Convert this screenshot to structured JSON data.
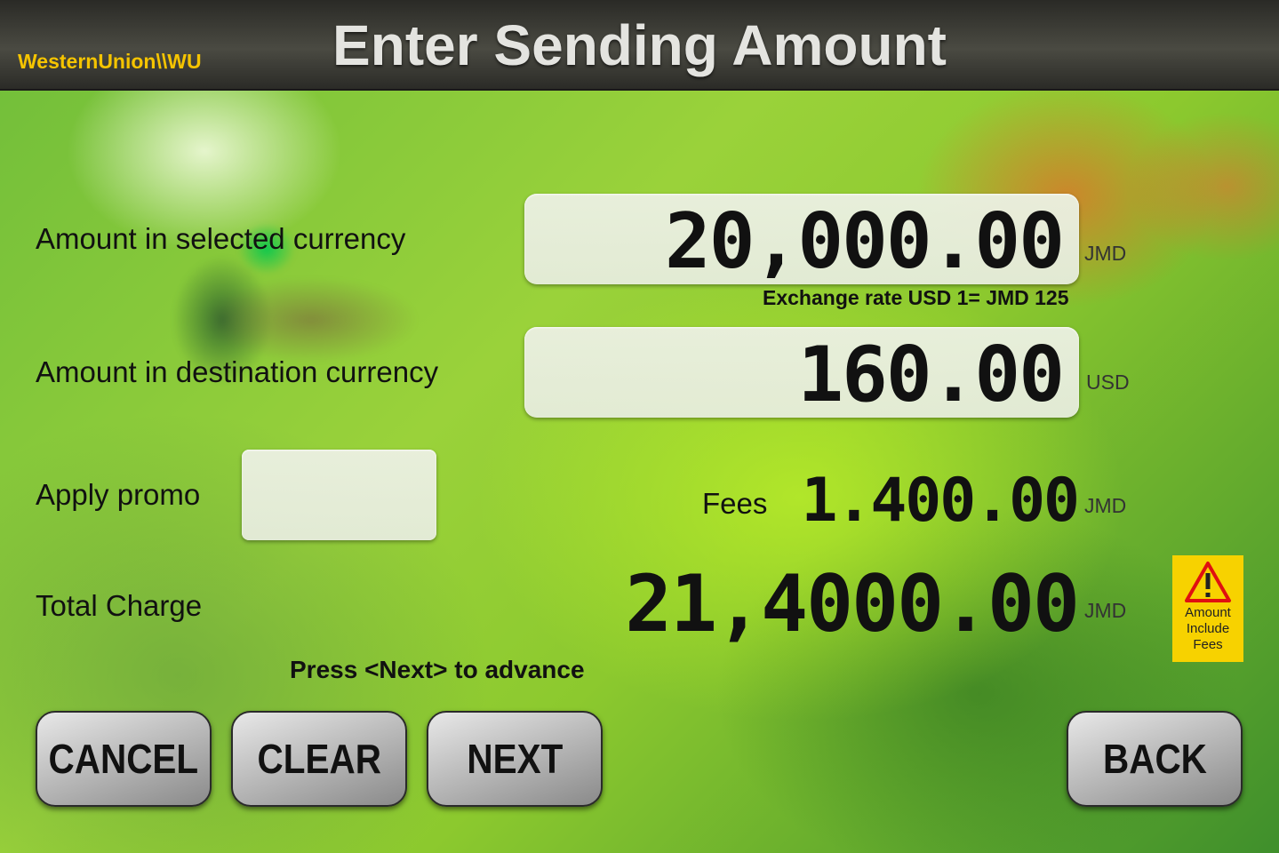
{
  "header": {
    "logo": "WesternUnion\\\\WU",
    "title": "Enter Sending Amount"
  },
  "form": {
    "selected_currency_label": "Amount in selected currency",
    "selected_amount": "20,000.00",
    "selected_currency_code": "JMD",
    "exchange_rate": "Exchange rate USD 1= JMD 125",
    "destination_currency_label": "Amount in destination currency",
    "destination_amount": "160.00",
    "destination_currency_code": "USD",
    "promo_label": "Apply promo",
    "promo_value": "",
    "fees_label": "Fees",
    "fees_amount": "1.400.00",
    "fees_currency_code": "JMD",
    "total_label": "Total Charge",
    "total_amount": "21,4000.00",
    "total_currency_code": "JMD",
    "warning_text": [
      "Amount",
      "Include",
      "Fees"
    ],
    "hint": "Press <Next> to advance"
  },
  "buttons": {
    "cancel": "CANCEL",
    "clear": "CLEAR",
    "next": "NEXT",
    "back": "BACK"
  },
  "colors": {
    "logo": "#f5c400",
    "warning_bg": "#f7d200",
    "warning_icon": "#e01010"
  },
  "icons": {
    "warning": "warning-triangle-icon"
  }
}
